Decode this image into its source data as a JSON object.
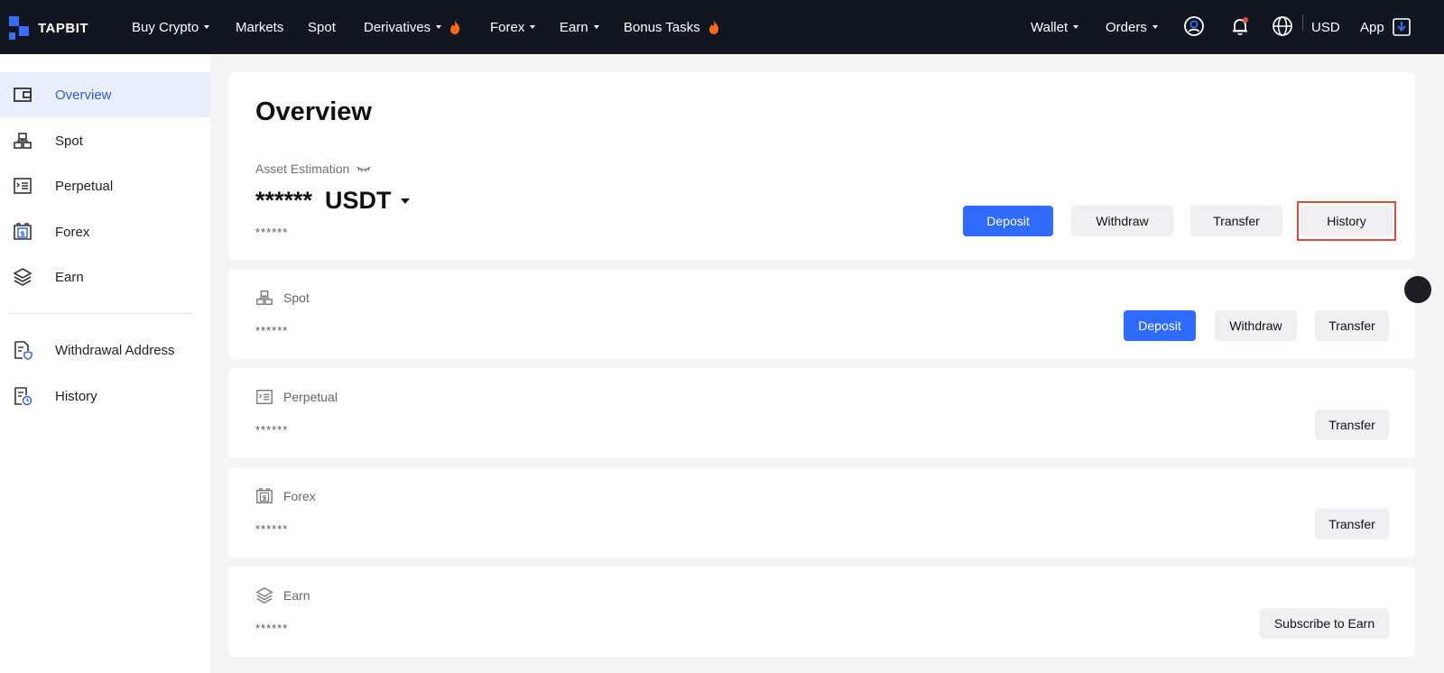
{
  "brand": {
    "name": "TAPBIT",
    "accent_color": "#2f6bff"
  },
  "topnav": {
    "items": [
      {
        "label": "Buy Crypto",
        "caret": true
      },
      {
        "label": "Markets"
      },
      {
        "label": "Spot"
      },
      {
        "label": "Derivatives",
        "caret": true,
        "hot": true
      },
      {
        "label": "Forex",
        "caret": true
      },
      {
        "label": "Earn",
        "caret": true
      },
      {
        "label": "Bonus Tasks",
        "hot": true
      }
    ],
    "right": {
      "wallet": "Wallet",
      "orders": "Orders",
      "currency": "USD",
      "app": "App"
    },
    "icons": [
      "profile-icon",
      "bell-icon",
      "globe-icon",
      "download-icon"
    ]
  },
  "sidebar": {
    "items": [
      {
        "label": "Overview",
        "icon": "wallet-icon",
        "active": true
      },
      {
        "label": "Spot",
        "icon": "spot-icon"
      },
      {
        "label": "Perpetual",
        "icon": "perpetual-icon"
      },
      {
        "label": "Forex",
        "icon": "forex-icon"
      },
      {
        "label": "Earn",
        "icon": "layers-icon"
      },
      {
        "label": "Withdrawal Address",
        "icon": "address-icon"
      },
      {
        "label": "History",
        "icon": "history-icon"
      }
    ]
  },
  "overview": {
    "title": "Overview",
    "asset_label": "Asset Estimation",
    "asset_value": "******",
    "asset_currency": "USDT",
    "asset_sub": "******",
    "buttons": {
      "deposit": "Deposit",
      "withdraw": "Withdraw",
      "transfer": "Transfer",
      "history": "History"
    }
  },
  "sections": [
    {
      "label": "Spot",
      "value": "******",
      "buttons": [
        "Deposit",
        "Withdraw",
        "Transfer"
      ]
    },
    {
      "label": "Perpetual",
      "value": "******",
      "buttons": [
        "Transfer"
      ]
    },
    {
      "label": "Forex",
      "value": "******",
      "buttons": [
        "Transfer"
      ]
    },
    {
      "label": "Earn",
      "value": "******",
      "buttons": [
        "Subscribe to Earn"
      ]
    }
  ]
}
